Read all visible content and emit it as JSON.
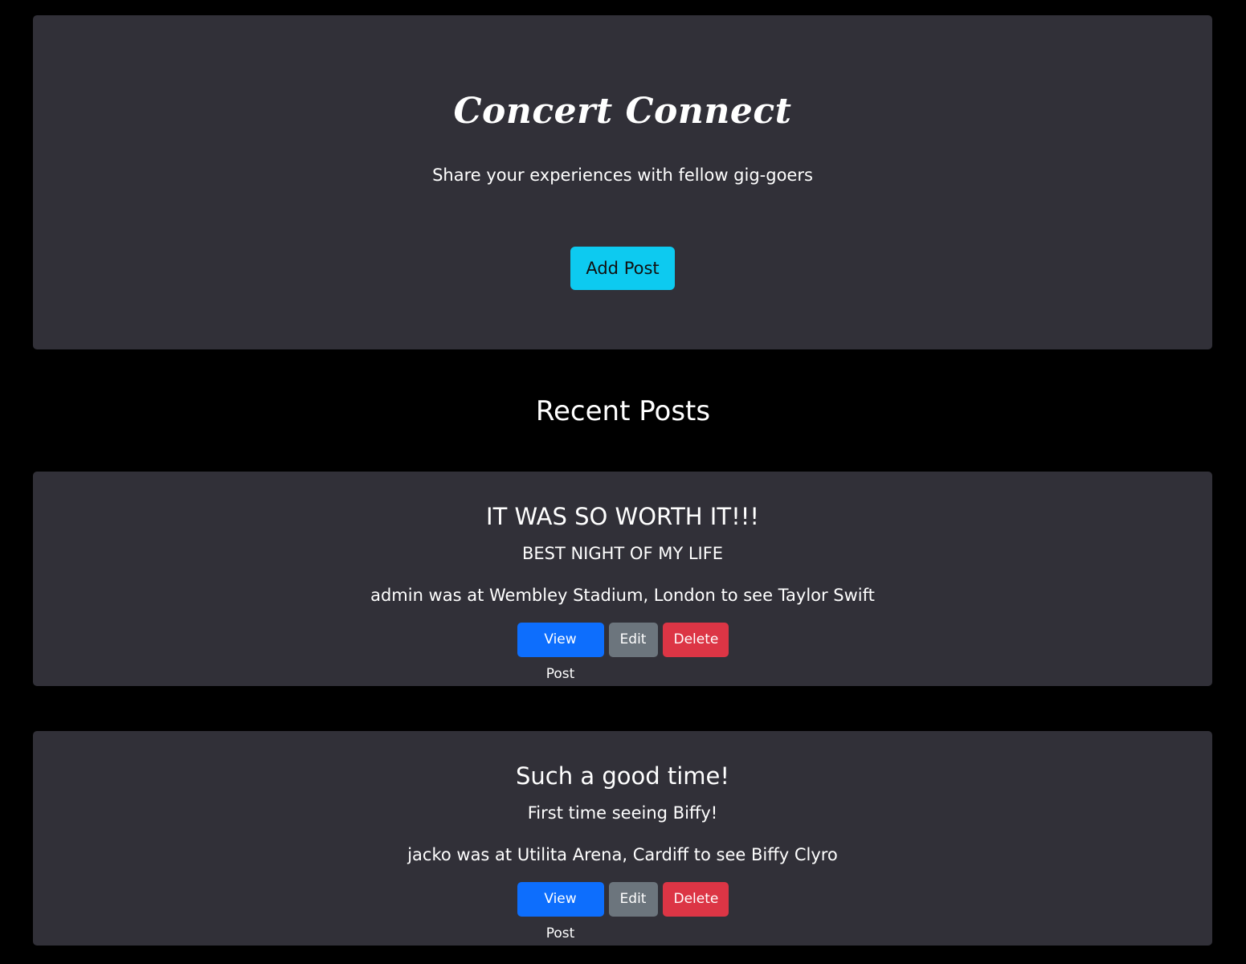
{
  "hero": {
    "title": "Concert Connect",
    "subtitle": "Share your experiences with fellow gig-goers",
    "add_post_label": "Add Post"
  },
  "recent": {
    "heading": "Recent Posts"
  },
  "posts": [
    {
      "title": "IT WAS SO WORTH IT!!!",
      "subtitle": "BEST NIGHT OF MY LIFE",
      "meta": "admin was at Wembley Stadium, London to see Taylor Swift",
      "view_label": "View Post",
      "edit_label": "Edit",
      "delete_label": "Delete"
    },
    {
      "title": "Such a good time!",
      "subtitle": "First time seeing Biffy!",
      "meta": "jacko was at Utilita Arena, Cardiff to see Biffy Clyro",
      "view_label": "View Post",
      "edit_label": "Edit",
      "delete_label": "Delete"
    }
  ],
  "colors": {
    "page_bg": "#000000",
    "card_bg": "#313038",
    "info": "#0dcaf0",
    "primary": "#0d6efd",
    "secondary": "#6c757d",
    "danger": "#dc3545"
  }
}
